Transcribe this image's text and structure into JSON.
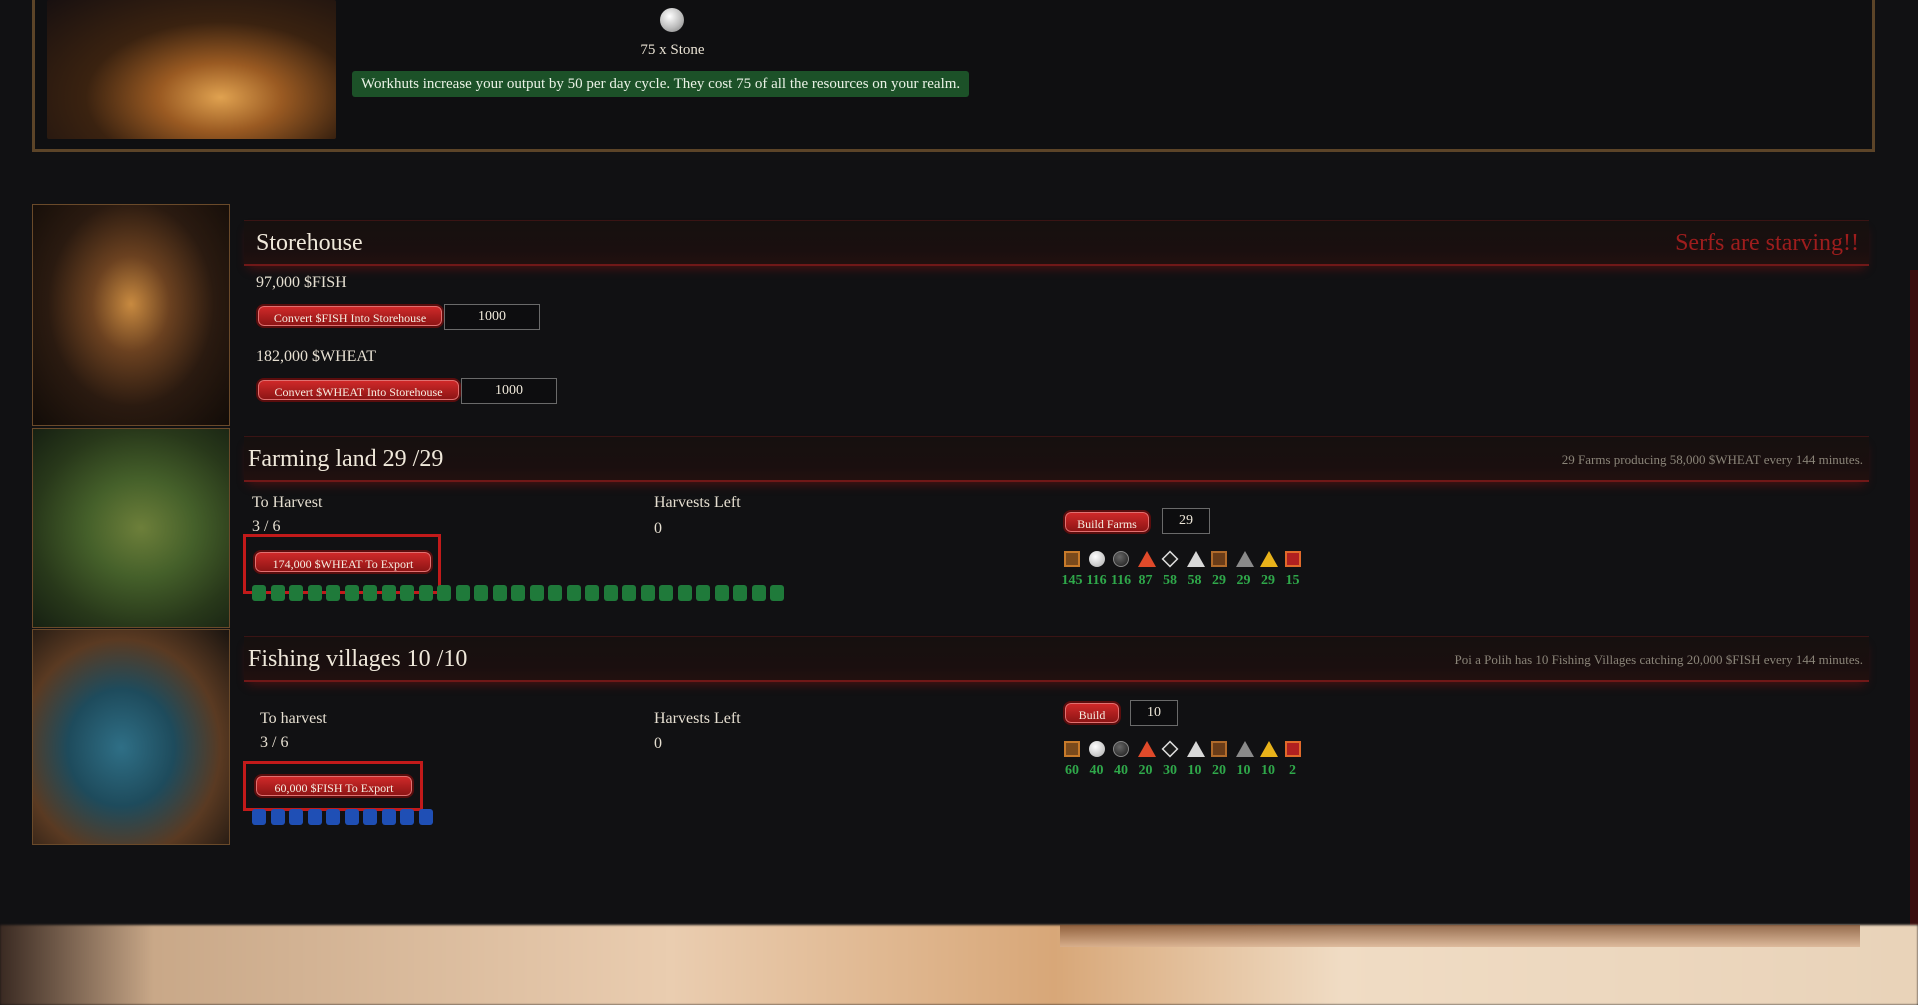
{
  "top": {
    "stone_label": "75 x Stone",
    "info_note": "Workhuts increase your output by 50 per day cycle. They cost 75 of all the resources on your realm."
  },
  "storehouse": {
    "title": "Storehouse",
    "alert": "Serfs are starving!!",
    "fish_amount": "97,000 $FISH",
    "fish_button": "Convert $FISH Into Storehouse",
    "fish_input_value": "1000",
    "wheat_amount": "182,000 $WHEAT",
    "wheat_button": "Convert $WHEAT Into Storehouse",
    "wheat_input_value": "1000"
  },
  "farming": {
    "title": "Farming land 29 /29",
    "summary": "29 Farms producing 58,000 $WHEAT every 144 minutes.",
    "to_harvest_label": "To Harvest",
    "to_harvest_value": "3 / 6",
    "harvests_left_label": "Harvests Left",
    "harvests_left_value": "0",
    "export_button": "174,000 $WHEAT To Export",
    "build_button": "Build Farms",
    "build_input_value": "29",
    "progress_cells": 29,
    "bar_color": "#1f7a3a",
    "resource_values": [
      "145",
      "116",
      "116",
      "87",
      "58",
      "58",
      "29",
      "29",
      "29",
      "15"
    ]
  },
  "fishing": {
    "title": "Fishing villages 10 /10",
    "summary": "Poi a Polih has 10 Fishing Villages catching 20,000 $FISH every 144 minutes.",
    "to_harvest_label": "To harvest",
    "to_harvest_value": "3 / 6",
    "harvests_left_label": "Harvests Left",
    "harvests_left_value": "0",
    "export_button": "60,000 $FISH To Export",
    "build_button": "Build",
    "build_input_value": "10",
    "progress_cells": 10,
    "bar_color": "#1f4fb5",
    "resource_values": [
      "60",
      "40",
      "40",
      "20",
      "30",
      "10",
      "20",
      "10",
      "10",
      "2"
    ]
  },
  "resource_icons": [
    "wood-icon",
    "stone-icon",
    "coal-icon",
    "ruby-icon",
    "diamond-icon",
    "silver-icon",
    "copper-icon",
    "ironwood-icon",
    "gold-icon",
    "dragonhide-icon"
  ],
  "colors": {
    "accent_red": "#c21a1a",
    "value_green": "#2fa84a",
    "note_green": "#1c5128"
  }
}
